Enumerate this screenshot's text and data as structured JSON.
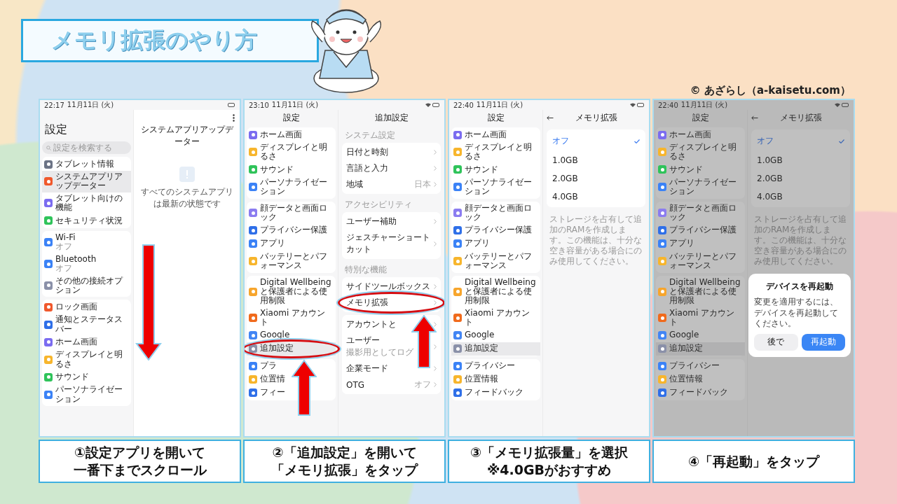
{
  "header": {
    "title": "メモリ拡張のやり方",
    "credit": "© あざらし（a-kaisetu.com）"
  },
  "steps": [
    {
      "scroll_arrow": true,
      "status": {
        "time": "22:17",
        "date": "11月11日 (火)",
        "wifi": false
      },
      "left": {
        "kind": "home",
        "title": "設定",
        "search": {
          "placeholder": "設定を検索する"
        },
        "groups": [
          {
            "items": [
              {
                "label": "タブレット情報",
                "color": "#6b7385",
                "selected": false,
                "circled": false
              },
              {
                "label": "システムアプリアップデーター",
                "color": "#f0582c",
                "selected": true,
                "circled": false
              },
              {
                "label": "タブレット向けの機能",
                "color": "#7b6cf0",
                "selected": false,
                "circled": false
              },
              {
                "label": "セキュリティ状況",
                "color": "#2fc35a",
                "selected": false,
                "circled": false
              }
            ]
          },
          {
            "items": [
              {
                "label": "Wi-Fi",
                "sub": "オフ",
                "color": "#3b82f6",
                "selected": false,
                "circled": false
              },
              {
                "label": "Bluetooth",
                "sub": "オフ",
                "color": "#3b82f6",
                "selected": false,
                "circled": false
              },
              {
                "label": "その他の接続オプション",
                "color": "#8a90a8",
                "selected": false,
                "circled": false
              }
            ]
          },
          {
            "items": [
              {
                "label": "ロック画面",
                "color": "#f0582c",
                "selected": false,
                "circled": false
              },
              {
                "label": "通知とステータスバー",
                "color": "#2f6fe8",
                "selected": false,
                "circled": false
              },
              {
                "label": "ホーム画面",
                "color": "#7b6cf0",
                "selected": false,
                "circled": false
              },
              {
                "label": "ディスプレイと明るさ",
                "color": "#f7b52c",
                "selected": false,
                "circled": false
              },
              {
                "label": "サウンド",
                "color": "#2fc35a",
                "selected": false,
                "circled": false
              },
              {
                "label": "パーソナライゼーション",
                "color": "#3b82f6",
                "selected": false,
                "circled": false
              }
            ]
          }
        ]
      },
      "right": {
        "kind": "update",
        "title": "システムアプリアップデーター",
        "message": "すべてのシステムアプリは最新の状態です"
      },
      "caption": [
        "①設定アプリを開いて",
        "一番下までスクロール"
      ]
    },
    {
      "status": {
        "time": "23:10",
        "date": "11月11日 (火)",
        "wifi": true
      },
      "left": {
        "kind": "scrolled",
        "title": "設定",
        "groups": [
          {
            "items": [
              {
                "label": "ホーム画面",
                "color": "#7b6cf0",
                "selected": false,
                "circled": false
              },
              {
                "label": "ディスプレイと明るさ",
                "color": "#f7b52c",
                "selected": false,
                "circled": false
              },
              {
                "label": "サウンド",
                "color": "#2fc35a",
                "selected": false,
                "circled": false
              },
              {
                "label": "パーソナライゼーション",
                "color": "#3b82f6",
                "selected": false,
                "circled": false
              }
            ]
          },
          {
            "items": [
              {
                "label": "顔データと画面ロック",
                "color": "#8b7cf0",
                "selected": false,
                "circled": false
              },
              {
                "label": "プライバシー保護",
                "color": "#2f6fe8",
                "selected": false,
                "circled": false
              },
              {
                "label": "アプリ",
                "color": "#3b82f6",
                "selected": false,
                "circled": false
              },
              {
                "label": "バッテリーとパフォーマンス",
                "color": "#f7b52c",
                "selected": false,
                "circled": false
              }
            ]
          },
          {
            "items": [
              {
                "label": "Digital Wellbeing と保護者による使用制限",
                "color": "#f7a52c",
                "selected": false,
                "circled": false
              },
              {
                "label": "Xiaomi アカウント",
                "color": "#f06a1c",
                "selected": false,
                "circled": false
              },
              {
                "label": "Google",
                "color": "#4285f4",
                "selected": false,
                "circled": false
              },
              {
                "label": "追加設定",
                "color": "#8a90a8",
                "selected": true,
                "circled": true
              }
            ]
          },
          {
            "items": [
              {
                "label": "プラ",
                "color": "#3b82f6",
                "selected": false,
                "circled": false
              },
              {
                "label": "位置情",
                "color": "#f7b52c",
                "selected": false,
                "circled": false
              },
              {
                "label": "フィー",
                "color": "#2f6fe8",
                "selected": false,
                "circled": false
              }
            ]
          }
        ]
      },
      "right": {
        "kind": "list",
        "title": "追加設定",
        "sections": [
          {
            "heading": "システム設定",
            "items": [
              {
                "label": "日付と時刻",
                "circled": false
              },
              {
                "label": "言語と入力",
                "circled": false
              },
              {
                "label": "地域",
                "value": "日本",
                "circled": false
              }
            ]
          },
          {
            "heading": "アクセシビリティ",
            "items": [
              {
                "label": "ユーザー補助",
                "circled": false
              },
              {
                "label": "ジェスチャーショートカット",
                "circled": false
              }
            ]
          },
          {
            "heading": "特別な機能",
            "items": [
              {
                "label": "サイドツールボックス",
                "circled": false
              },
              {
                "label": "メモリ拡張",
                "circled": true
              }
            ]
          },
          {
            "items": [
              {
                "label": "アカウントと",
                "circled": false
              },
              {
                "label": "ユーザー",
                "sub": "撮影用としてログ",
                "circled": false
              },
              {
                "label": "企業モード",
                "circled": false
              },
              {
                "label": "OTG",
                "value": "オフ",
                "circled": false
              }
            ]
          }
        ]
      },
      "caption": [
        "②「追加設定」を開いて",
        "「メモリ拡張」をタップ"
      ]
    },
    {
      "status": {
        "time": "22:40",
        "date": "11月11日 (火)",
        "wifi": true
      },
      "left": {
        "kind": "scrolled",
        "title": "設定",
        "groups": [
          {
            "items": [
              {
                "label": "ホーム画面",
                "color": "#7b6cf0",
                "selected": false,
                "circled": false
              },
              {
                "label": "ディスプレイと明るさ",
                "color": "#f7b52c",
                "selected": false,
                "circled": false
              },
              {
                "label": "サウンド",
                "color": "#2fc35a",
                "selected": false,
                "circled": false
              },
              {
                "label": "パーソナライゼーション",
                "color": "#3b82f6",
                "selected": false,
                "circled": false
              }
            ]
          },
          {
            "items": [
              {
                "label": "顔データと画面ロック",
                "color": "#8b7cf0",
                "selected": false,
                "circled": false
              },
              {
                "label": "プライバシー保護",
                "color": "#2f6fe8",
                "selected": false,
                "circled": false
              },
              {
                "label": "アプリ",
                "color": "#3b82f6",
                "selected": false,
                "circled": false
              },
              {
                "label": "バッテリーとパフォーマンス",
                "color": "#f7b52c",
                "selected": false,
                "circled": false
              }
            ]
          },
          {
            "items": [
              {
                "label": "Digital Wellbeing と保護者による使用制限",
                "color": "#f7a52c",
                "selected": false,
                "circled": false
              },
              {
                "label": "Xiaomi アカウント",
                "color": "#f06a1c",
                "selected": false,
                "circled": false
              },
              {
                "label": "Google",
                "color": "#4285f4",
                "selected": false,
                "circled": false
              },
              {
                "label": "追加設定",
                "color": "#8a90a8",
                "selected": true,
                "circled": false
              }
            ]
          },
          {
            "items": [
              {
                "label": "プライバシー",
                "color": "#3b82f6",
                "selected": false,
                "circled": false
              },
              {
                "label": "位置情報",
                "color": "#f7b52c",
                "selected": false,
                "circled": false
              },
              {
                "label": "フィードバック",
                "color": "#2f6fe8",
                "selected": false,
                "circled": false
              }
            ]
          }
        ]
      },
      "right": {
        "kind": "options",
        "title": "メモリ拡張",
        "options": [
          {
            "label": "オフ",
            "selected": true
          },
          {
            "label": "1.0GB",
            "selected": false
          },
          {
            "label": "2.0GB",
            "selected": false
          },
          {
            "label": "4.0GB",
            "selected": false
          }
        ],
        "note": "ストレージを占有して追加のRAMを作成します。この機能は、十分な空き容量がある場合にのみ使用してください。"
      },
      "caption": [
        "③「メモリ拡張量」を選択",
        "※4.0GBがおすすめ"
      ]
    },
    {
      "status": {
        "time": "22:40",
        "date": "11月11日 (火)",
        "wifi": true
      },
      "left": {
        "kind": "scrolled",
        "title": "設定",
        "groups": [
          {
            "items": [
              {
                "label": "ホーム画面",
                "color": "#7b6cf0",
                "selected": false,
                "circled": false
              },
              {
                "label": "ディスプレイと明るさ",
                "color": "#f7b52c",
                "selected": false,
                "circled": false
              },
              {
                "label": "サウンド",
                "color": "#2fc35a",
                "selected": false,
                "circled": false
              },
              {
                "label": "パーソナライゼーション",
                "color": "#3b82f6",
                "selected": false,
                "circled": false
              }
            ]
          },
          {
            "items": [
              {
                "label": "顔データと画面ロック",
                "color": "#8b7cf0",
                "selected": false,
                "circled": false
              },
              {
                "label": "プライバシー保護",
                "color": "#2f6fe8",
                "selected": false,
                "circled": false
              },
              {
                "label": "アプリ",
                "color": "#3b82f6",
                "selected": false,
                "circled": false
              },
              {
                "label": "バッテリーとパフォーマンス",
                "color": "#f7b52c",
                "selected": false,
                "circled": false
              }
            ]
          },
          {
            "items": [
              {
                "label": "Digital Wellbeing と保護者による使用制限",
                "color": "#f7a52c",
                "selected": false,
                "circled": false
              },
              {
                "label": "Xiaomi アカウント",
                "color": "#f06a1c",
                "selected": false,
                "circled": false
              },
              {
                "label": "Google",
                "color": "#4285f4",
                "selected": false,
                "circled": false
              },
              {
                "label": "追加設定",
                "color": "#8a90a8",
                "selected": true,
                "circled": false
              }
            ]
          },
          {
            "items": [
              {
                "label": "プライバシー",
                "color": "#3b82f6",
                "selected": false,
                "circled": false
              },
              {
                "label": "位置情報",
                "color": "#f7b52c",
                "selected": false,
                "circled": false
              },
              {
                "label": "フィードバック",
                "color": "#2f6fe8",
                "selected": false,
                "circled": false
              }
            ]
          }
        ]
      },
      "right": {
        "kind": "options",
        "title": "メモリ拡張",
        "options": [
          {
            "label": "オフ",
            "selected": true
          },
          {
            "label": "1.0GB",
            "selected": false
          },
          {
            "label": "2.0GB",
            "selected": false
          },
          {
            "label": "4.0GB",
            "selected": false
          }
        ],
        "note": "ストレージを占有して追加のRAMを作成します。この機能は、十分な空き容量がある場合にのみ使用してください。"
      },
      "dialog": {
        "title": "デバイスを再起動",
        "message": "変更を適用するには、デバイスを再起動してください。",
        "buttons": [
          {
            "label": "後で",
            "primary": false
          },
          {
            "label": "再起動",
            "primary": true
          }
        ]
      },
      "caption": [
        "④「再起動」をタップ"
      ]
    }
  ]
}
